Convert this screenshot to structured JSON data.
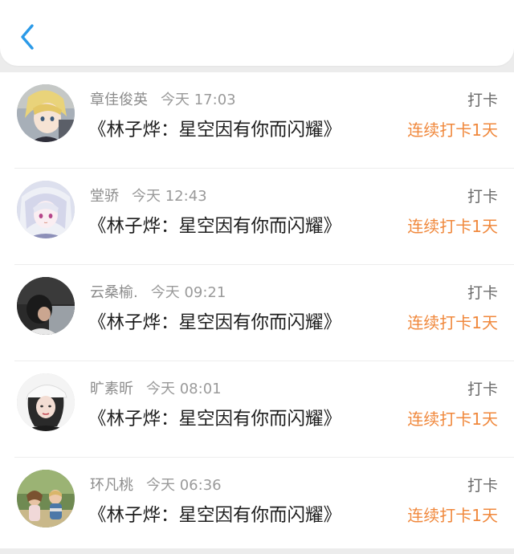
{
  "header": {
    "back_icon": "chevron-left-icon",
    "accent_color": "#2b9ae8"
  },
  "entries": [
    {
      "name": "章佳俊英",
      "time": "今天 17:03",
      "title": "《林子烨：星空因有你而闪耀》",
      "action": "打卡",
      "streak": "连续打卡1天",
      "avatar_icon": "anime-boy-avatar"
    },
    {
      "name": "堂骄",
      "time": "今天 12:43",
      "title": "《林子烨：星空因有你而闪耀》",
      "action": "打卡",
      "streak": "连续打卡1天",
      "avatar_icon": "anime-girl-avatar"
    },
    {
      "name": "云桑榆.",
      "time": "今天 09:21",
      "title": "《林子烨：星空因有你而闪耀》",
      "action": "打卡",
      "streak": "连续打卡1天",
      "avatar_icon": "dark-photo-avatar"
    },
    {
      "name": "旷素昕",
      "time": "今天 08:01",
      "title": "《林子烨：星空因有你而闪耀》",
      "action": "打卡",
      "streak": "连续打卡1天",
      "avatar_icon": "girl-cap-avatar"
    },
    {
      "name": "环凡桃",
      "time": "今天 06:36",
      "title": "《林子烨：星空因有你而闪耀》",
      "action": "打卡",
      "streak": "连续打卡1天",
      "avatar_icon": "kids-outdoor-avatar"
    }
  ],
  "colors": {
    "name_text": "#8c8c8c",
    "title_text": "#1e1e1e",
    "streak_text": "#f0883c",
    "action_text": "#6a6a6a"
  }
}
